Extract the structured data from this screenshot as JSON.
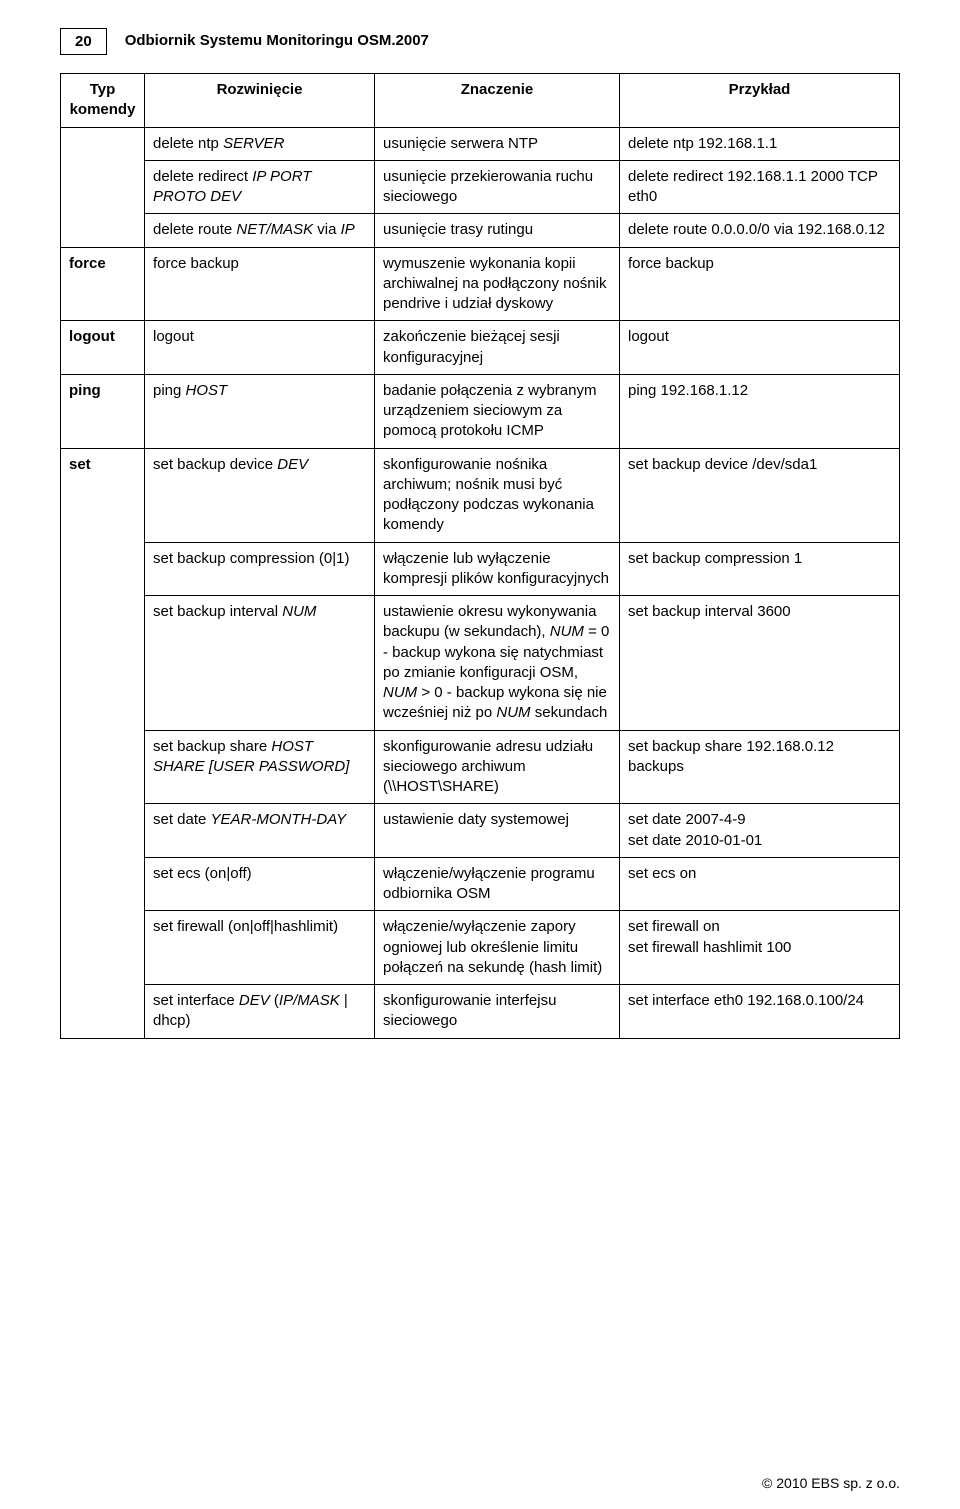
{
  "pageNumber": "20",
  "docTitle": "Odbiornik Systemu Monitoringu OSM.2007",
  "headers": {
    "col1": "Typ komendy",
    "col2": "Rozwinięcie",
    "col3": "Znaczenie",
    "col4": "Przykład"
  },
  "rows": [
    {
      "type": "",
      "typeRowspan": 0,
      "expansion": "delete ntp <i>SERVER</i>",
      "meaning": "usunięcie serwera NTP",
      "example": "delete ntp 192.168.1.1"
    },
    {
      "expansion": "delete redirect <i>IP PORT PROTO DEV</i>",
      "meaning": "usunięcie przekierowania ruchu sieciowego",
      "example": "delete redirect 192.168.1.1 2000 TCP eth0"
    },
    {
      "expansion": "delete route <i>NET/MASK</i> via <i>IP</i>",
      "meaning": "usunięcie trasy rutingu",
      "example": "delete route 0.0.0.0/0 via 192.168.0.12"
    },
    {
      "type": "force",
      "expansion": "force backup",
      "meaning": "wymuszenie wykonania kopii archiwalnej na podłączony nośnik pendrive i udział dyskowy",
      "example": "force backup"
    },
    {
      "type": "logout",
      "expansion": "logout",
      "meaning": "zakończenie bieżącej sesji konfiguracyjnej",
      "example": "logout"
    },
    {
      "type": "ping",
      "expansion": "ping <i>HOST</i>",
      "meaning": "badanie połączenia z wybranym urządzeniem sieciowym za pomocą protokołu ICMP",
      "example": "ping 192.168.1.12"
    },
    {
      "type": "set",
      "typeRowspan": 9,
      "expansion": "set backup device <i>DEV</i>",
      "meaning": "skonfigurowanie nośnika archiwum; nośnik musi być podłączony podczas wykonania komendy",
      "example": "set backup device /dev/sda1"
    },
    {
      "expansion": "set backup compression (0|1)",
      "meaning": "włączenie lub wyłączenie kompresji plików konfiguracyjnych",
      "example": "set backup compression 1"
    },
    {
      "expansion": "set backup interval <i>NUM</i>",
      "meaning": "ustawienie okresu wykonywania backupu (w sekundach), <i>NUM</i> = 0 - backup wykona się natychmiast po zmianie konfiguracji OSM, <i>NUM</i> > 0  - backup wykona się nie wcześniej niż po <i>NUM</i> sekundach",
      "example": "set backup interval 3600"
    },
    {
      "expansion": "set backup share <i>HOST SHARE [USER PASSWORD]</i>",
      "meaning": "skonfigurowanie adresu udziału sieciowego archiwum (\\\\HOST\\SHARE)",
      "example": "set backup share 192.168.0.12 backups"
    },
    {
      "expansion": "set date <i>YEAR-MONTH-DAY</i>",
      "meaning": "ustawienie daty systemowej",
      "example": "set date 2007-4-9\nset date 2010-01-01"
    },
    {
      "expansion": "set ecs (on|off)",
      "meaning": "włączenie/wyłączenie programu odbiornika OSM",
      "example": "set ecs on"
    },
    {
      "expansion": "set firewall (on|off|hashlimit)",
      "meaning": "włączenie/wyłączenie zapory ogniowej lub określenie limitu połączeń na sekundę (hash limit)",
      "example": "set firewall on\nset firewall hashlimit 100"
    },
    {
      "expansion": "set interface <i>DEV</i> (<i>IP/MASK</i> | dhcp)",
      "meaning": "skonfigurowanie interfejsu sieciowego",
      "example": "set interface eth0 192.168.0.100/24"
    }
  ],
  "footer": "© 2010 EBS sp. z o.o."
}
